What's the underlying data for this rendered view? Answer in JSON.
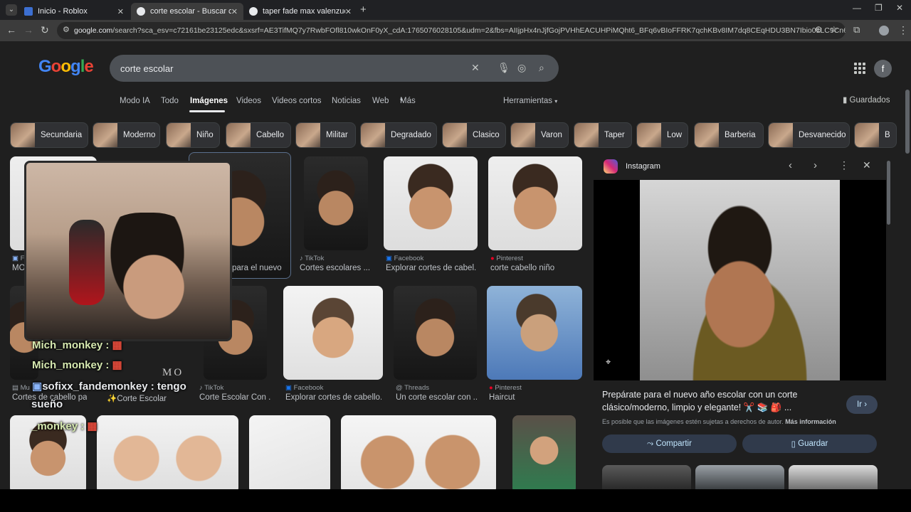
{
  "tabs": [
    {
      "title": "Inicio - Roblox",
      "active": false
    },
    {
      "title": "corte escolar - Buscar con Google",
      "active": true
    },
    {
      "title": "taper fade max valenzuela - Bu",
      "active": false
    }
  ],
  "new_tab_label": "+",
  "address": {
    "host": "google.com",
    "path": "/search?sca_esv=c72161be23125edc&sxsrf=AE3TifMQ7y7RwbFOfl810wkOnF0yX_cdA:1765076028105&udm=2&fbs=AIIjpHx4nJjfGojPVHhEACUHPiMQht6_BFq6vBIoFFRK7qchKBv8IM7dq8CEqHDU3BN7Ibio0LLC9Cn6mkAPuJ2pf_5AB2jIEfe..."
  },
  "search": {
    "logo": "Google",
    "query": "corte escolar"
  },
  "account_initial": "f",
  "nav_tabs": [
    "Modo IA",
    "Todo",
    "Imágenes",
    "Videos",
    "Videos cortos",
    "Noticias",
    "Web",
    "Más"
  ],
  "active_tab": "Imágenes",
  "tools_label": "Herramientas",
  "saved_label": "Guardados",
  "chips": [
    "Secundaria",
    "Moderno",
    "Niño",
    "Cabello",
    "Militar",
    "Degradado",
    "Clasico",
    "Varon",
    "Taper",
    "Low",
    "Barberia",
    "Desvanecido",
    "B"
  ],
  "results": [
    {
      "source": "F",
      "caption": "MO"
    },
    {
      "source": "",
      "caption": "para el nuevo..."
    },
    {
      "source": "TikTok",
      "caption": "Cortes escolares ..."
    },
    {
      "source": "Facebook",
      "caption": "Explorar cortes de cabel..."
    },
    {
      "source": "Pinterest",
      "caption": "corte cabello niño"
    },
    {
      "source": "Mu",
      "caption": "Cortes de cabello pa..."
    },
    {
      "source": "",
      "caption": "Corte Escolar"
    },
    {
      "source": "TikTok",
      "caption": "Corte Escolar Con ..."
    },
    {
      "source": "Facebook",
      "caption": "Explorar cortes de cabello..."
    },
    {
      "source": "Threads",
      "caption": "Un corte escolar con ..."
    },
    {
      "source": "Pinterest",
      "caption": "Haircut"
    }
  ],
  "panel": {
    "source": "Instagram",
    "title": "Prepárate para el nuevo año escolar con un corte clásico/moderno, limpio y elegante! ✂️ 📚 🎒 ...",
    "visit_label": "Ir ›",
    "copyright_text": "Es posible que las imágenes estén sujetas a derechos de autor.",
    "more_info": "Más información",
    "share_label": "Compartir",
    "save_label": "Guardar"
  },
  "overlay": {
    "chat": [
      "Mich_monkey :",
      "Mich_monkey :",
      "sofixx_fandemonkey : tengo",
      "sueño",
      "_monkey :"
    ],
    "watermark": "MO"
  },
  "colors": {
    "accent": "#8ab4f8",
    "background": "#1f1f1f",
    "tiktok": "#e8eaed",
    "facebook": "#1877f2",
    "pinterest": "#e60023",
    "instagram": "#d6249f"
  }
}
